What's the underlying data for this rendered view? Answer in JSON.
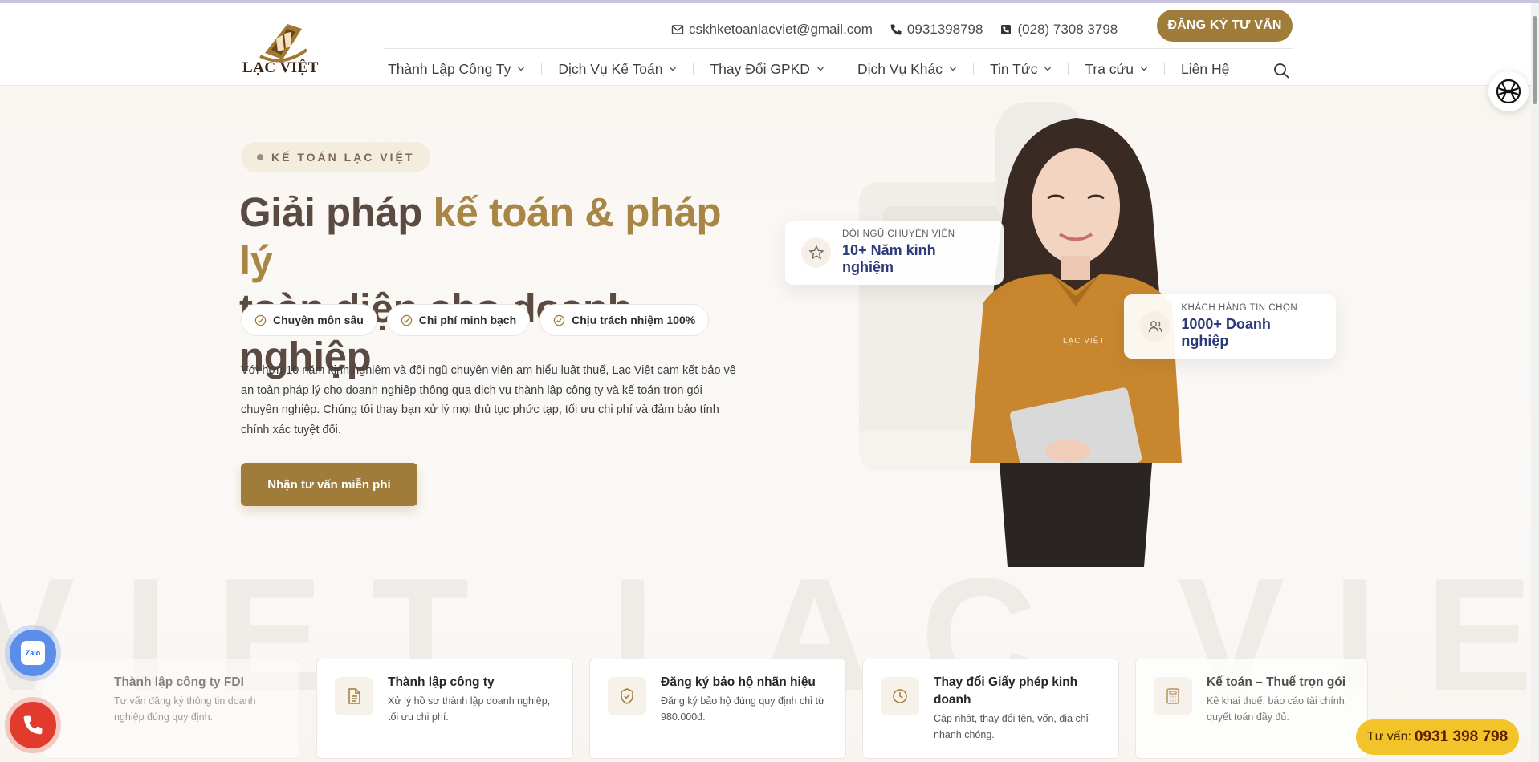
{
  "header": {
    "logo_text": "LẠC VIỆT",
    "email": "cskhketoanlacviet@gmail.com",
    "phone_mobile": "0931398798",
    "phone_office": "(028) 7308 3798",
    "register_button": "ĐĂNG KÝ TƯ VẤN",
    "nav": [
      {
        "label": "Thành Lập Công Ty",
        "dropdown": true
      },
      {
        "label": "Dịch Vụ Kế Toán",
        "dropdown": true
      },
      {
        "label": "Thay Đổi GPKD",
        "dropdown": true
      },
      {
        "label": "Dịch Vụ Khác",
        "dropdown": true
      },
      {
        "label": "Tin Tức",
        "dropdown": true
      },
      {
        "label": "Tra cứu",
        "dropdown": true
      },
      {
        "label": "Liên Hệ",
        "dropdown": false
      }
    ]
  },
  "hero": {
    "badge": "KẾ TOÁN LẠC VIỆT",
    "title_part1": "Giải pháp ",
    "title_highlight": "kế toán & pháp lý",
    "title_part2": "toàn diện cho doanh nghiệp",
    "chips": [
      "Chuyên môn sâu",
      "Chi phí minh bạch",
      "Chịu trách nhiệm 100%"
    ],
    "description": "Với hơn 10 năm kinh nghiệm và đội ngũ chuyên viên am hiểu luật thuế, Lạc Việt cam kết bảo vệ an toàn pháp lý cho doanh nghiệp thông qua dịch vụ thành lập công ty và kế toán trọn gói chuyên nghiệp. Chúng tôi thay bạn xử lý mọi thủ tục phức tạp, tối ưu chi phí và đảm bảo tính chính xác tuyệt đối.",
    "cta": "Nhận tư vấn miễn phí",
    "watermark": "VIET LAC VIET",
    "stat1_label": "ĐỘI NGŨ CHUYÊN VIÊN",
    "stat1_value": "10+ Năm kinh nghiệm",
    "stat2_label": "KHÁCH HÀNG TIN CHỌN",
    "stat2_value": "1000+ Doanh nghiệp",
    "shirt_text": "LẠC VIỆT"
  },
  "services": [
    {
      "title": "Thành lập công ty FDI",
      "desc": "Tư vấn đăng ký thông tin doanh nghiệp đúng quy định.",
      "icon": "building-icon"
    },
    {
      "title": "Thành lập công ty",
      "desc": "Xử lý hồ sơ thành lập doanh nghiệp, tối ưu chi phí.",
      "icon": "document-icon"
    },
    {
      "title": "Đăng ký bảo hộ nhãn hiệu",
      "desc": "Đăng ký bảo hộ đúng quy định chỉ từ 980.000đ.",
      "icon": "shield-check-icon"
    },
    {
      "title": "Thay đổi Giấy phép kinh doanh",
      "desc": "Cập nhật, thay đổi tên, vốn, địa chỉ nhanh chóng.",
      "icon": "clock-icon"
    },
    {
      "title": "Kế toán – Thuế trọn gói",
      "desc": "Kê khai thuế, báo cáo tài chính, quyết toán đầy đủ.",
      "icon": "calculator-icon"
    }
  ],
  "widgets": {
    "zalo_label": "Zalo",
    "hotline_prefix": "Tư vấn:",
    "hotline_number": "0931 398 798"
  },
  "colors": {
    "brand_gold": "#a07c3b",
    "heading_brown": "#5a4a42",
    "highlight_gold": "#a88645",
    "stat_navy": "#2d3a78",
    "hotline_yellow": "#f3c32a"
  }
}
